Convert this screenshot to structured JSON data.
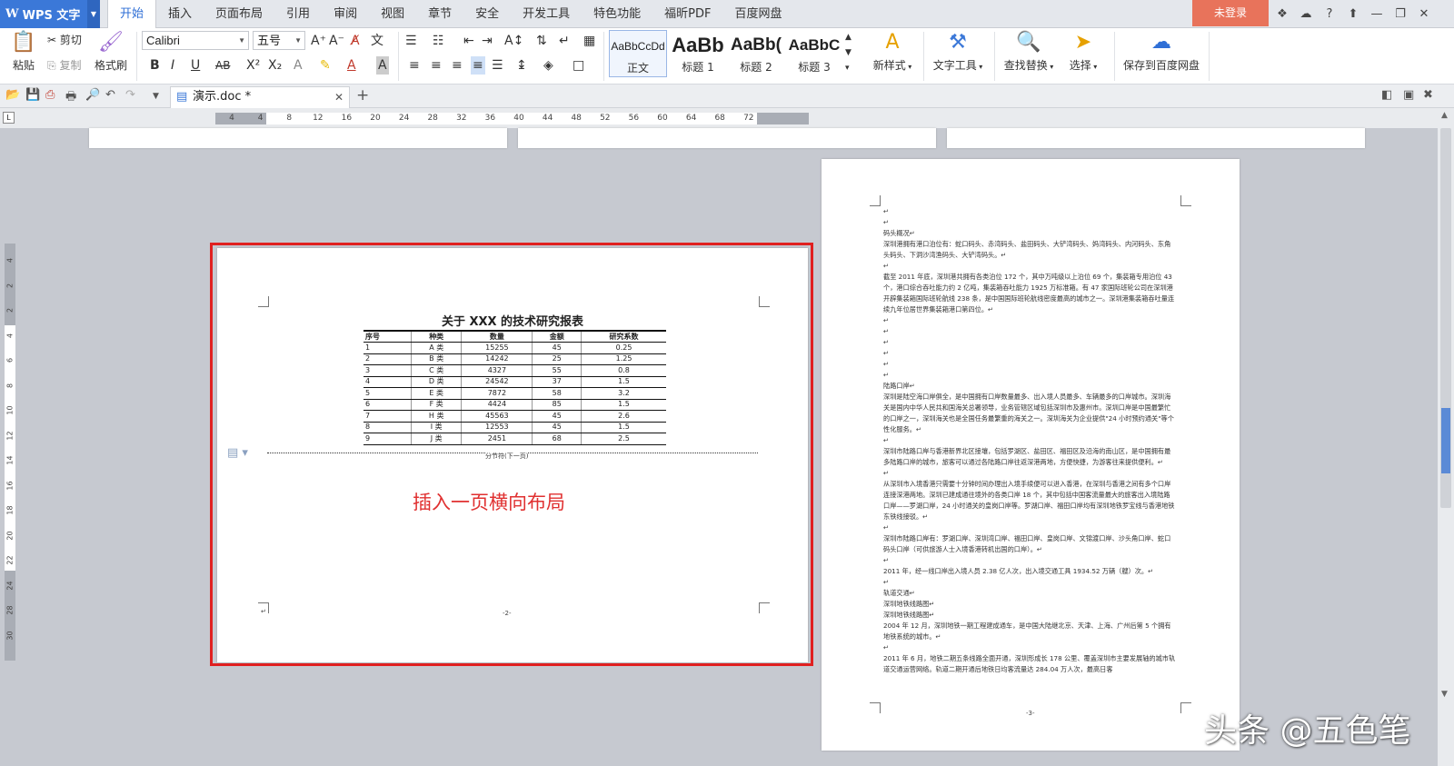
{
  "app": {
    "name": "WPS 文字",
    "logo": "W"
  },
  "menu": {
    "tabs": [
      "开始",
      "插入",
      "页面布局",
      "引用",
      "审阅",
      "视图",
      "章节",
      "安全",
      "开发工具",
      "特色功能",
      "福昕PDF",
      "百度网盘"
    ],
    "login": "未登录"
  },
  "ribbon": {
    "paste": "粘贴",
    "cut": "剪切",
    "copy": "复制",
    "format_painter": "格式刷",
    "font_name": "Calibri",
    "font_size": "五号",
    "styles": [
      {
        "sample": "AaBbCcDd",
        "name": "正文"
      },
      {
        "sample": "AaBb",
        "name": "标题 1"
      },
      {
        "sample": "AaBb(",
        "name": "标题 2"
      },
      {
        "sample": "AaBbC",
        "name": "标题 3"
      }
    ],
    "new_style": "新样式",
    "text_tools": "文字工具",
    "find_replace": "查找替换",
    "select": "选择",
    "save_cloud": "保存到百度网盘"
  },
  "doc_tab": {
    "title": "演示.doc *"
  },
  "ruler": {
    "h_ticks": [
      "4",
      "4",
      "8",
      "12",
      "16",
      "20",
      "24",
      "28",
      "32",
      "36",
      "40",
      "44",
      "48",
      "52",
      "56",
      "60",
      "64",
      "68",
      "72"
    ],
    "v_ticks": [
      "4",
      "2",
      "2",
      "4",
      "6",
      "8",
      "10",
      "12",
      "14",
      "16",
      "18",
      "20",
      "22",
      "24",
      "28",
      "30"
    ]
  },
  "landscape_page": {
    "title": "关于 XXX 的技术研究报表",
    "table": {
      "headers": [
        "序号",
        "种类",
        "数量",
        "金额",
        "研究系数"
      ],
      "rows": [
        [
          "1",
          "A 类",
          "15255",
          "45",
          "0.25"
        ],
        [
          "2",
          "B 类",
          "14242",
          "25",
          "1.25"
        ],
        [
          "3",
          "C 类",
          "4327",
          "55",
          "0.8"
        ],
        [
          "4",
          "D 类",
          "24542",
          "37",
          "1.5"
        ],
        [
          "5",
          "E 类",
          "7872",
          "58",
          "3.2"
        ],
        [
          "6",
          "F 类",
          "4424",
          "85",
          "1.5"
        ],
        [
          "7",
          "H 类",
          "45563",
          "45",
          "2.6"
        ],
        [
          "8",
          "I 类",
          "12553",
          "45",
          "1.5"
        ],
        [
          "9",
          "J 类",
          "2451",
          "68",
          "2.5"
        ]
      ]
    },
    "section_break": "分节符(下一页)",
    "annotation": "插入一页横向布局",
    "page_number": "-2-"
  },
  "portrait_page": {
    "paragraphs": [
      "↵",
      "↵",
      "码头概况↵",
      "深圳港拥有港口泊位有：蛇口码头、赤湾码头、盐田码头、大铲湾码头、妈湾码头、内河码头、东角头码头、下洞沙湾渔码头、大铲湾码头。↵",
      "↵",
      "截至 2011 年底，深圳港共拥有各类泊位 172 个，其中万吨级以上泊位 69 个，集装箱专用泊位 43 个，港口综合吞吐能力约 2 亿吨，集装箱吞吐能力 1925 万标准箱。有 47 家国际班轮公司在深圳港开辟集装箱国际班轮航线 238 条，是中国国际班轮航线密度最高的城市之一。深圳港集装箱吞吐量连续九年位居世界集装箱港口第四位。↵",
      "↵",
      "↵",
      "↵",
      "↵",
      "↵",
      "↵",
      "陆路口岸↵",
      "深圳是陆空海口岸俱全，是中国拥有口岸数量最多、出入境人员最多、车辆最多的口岸城市。深圳海关是国内中华人民共和国海关总署领导，业务管辖区域包括深圳市及惠州市。深圳口岸是中国最繁忙的口岸之一，深圳海关也是全国任务最繁重的海关之一。深圳海关为企业提供\"24 小时预约通关\"等个性化服务。↵",
      "↵",
      "深圳市陆路口岸与香港新界北区接壤，包括罗湖区、盐田区、福田区及沿海的南山区，是中国拥有最多陆路口岸的城市，旅客可以通过各陆路口岸往返深港两地，方便快捷，为游客往来提供便利。↵",
      "↵",
      "从深圳市入境香港只需要十分钟时间办理出入境手续便可以进入香港，在深圳与香港之间有多个口岸连接深港两地。深圳已建成通往境外的各类口岸 18 个，其中包括中国客流量最大的旅客出入境陆路口岸——罗湖口岸，24 小时通关的皇岗口岸等。罗湖口岸、福田口岸均有深圳地铁罗宝线与香港地铁东铁线接驳。↵",
      "↵",
      "深圳市陆路口岸有：罗湖口岸、深圳湾口岸、福田口岸、皇岗口岸、文锦渡口岸、沙头角口岸、蛇口码头口岸（可供旅游人士入境香港转机出国的口岸）。↵",
      "↵",
      "2011 年，经一线口岸出入境人员 2.38 亿人次，出入境交通工具 1934.52 万辆（艘）次。↵",
      "↵",
      "轨道交通↵",
      "深圳地铁线路图↵",
      "深圳地铁线路图↵",
      "2004 年 12 月，深圳地铁一期工程建成通车，是中国大陆继北京、天津、上海、广州后第 5 个拥有地铁系统的城市。↵",
      "↵",
      "2011 年 6 月，地铁二期五条线路全面开通，深圳形成长 178 公里、覆盖深圳市主要发展轴的城市轨道交通运营网络。轨道二期开通后地铁日均客流量达 284.04 万人次，最高日客"
    ],
    "page_number": "-3-"
  },
  "watermark": "头条 @五色笔",
  "colors": {
    "brand": "#3b78d8",
    "login": "#e8735b",
    "annotation": "#e03030",
    "frame": "#e02020"
  }
}
